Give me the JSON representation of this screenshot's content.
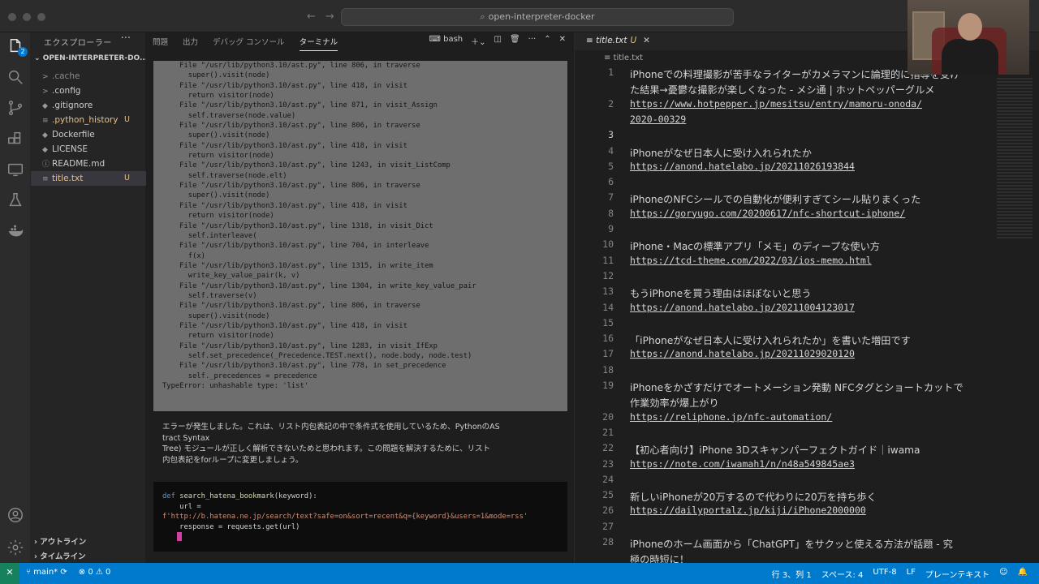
{
  "window": {
    "command_center": "open-interpreter-docker"
  },
  "explorer": {
    "title": "エクスプローラー",
    "more": "···",
    "folder": "OPEN-INTERPRETER-DO...",
    "items": [
      {
        "name": ".cache",
        "icon": ">",
        "status": ""
      },
      {
        "name": ".config",
        "icon": ">",
        "status": ""
      },
      {
        "name": ".gitignore",
        "icon": "◆",
        "status": ""
      },
      {
        "name": ".python_history",
        "icon": "≡",
        "status": "U"
      },
      {
        "name": "Dockerfile",
        "icon": "◆",
        "status": ""
      },
      {
        "name": "LICENSE",
        "icon": "◆",
        "status": ""
      },
      {
        "name": "README.md",
        "icon": "ⓘ",
        "status": ""
      },
      {
        "name": "title.txt",
        "icon": "≡",
        "status": "U"
      }
    ],
    "outline": "アウトライン",
    "timeline": "タイムライン"
  },
  "panel": {
    "tabs": [
      "問題",
      "出力",
      "デバッグ コンソール",
      "ターミナル"
    ],
    "shell": "bash",
    "traceback": [
      "    File \"/usr/lib/python3.10/ast.py\", line 806, in traverse",
      "      super().visit(node)",
      "    File \"/usr/lib/python3.10/ast.py\", line 418, in visit",
      "      return visitor(node)",
      "    File \"/usr/lib/python3.10/ast.py\", line 871, in visit_Assign",
      "      self.traverse(node.value)",
      "    File \"/usr/lib/python3.10/ast.py\", line 806, in traverse",
      "      super().visit(node)",
      "    File \"/usr/lib/python3.10/ast.py\", line 418, in visit",
      "      return visitor(node)",
      "    File \"/usr/lib/python3.10/ast.py\", line 1243, in visit_ListComp",
      "      self.traverse(node.elt)",
      "    File \"/usr/lib/python3.10/ast.py\", line 806, in traverse",
      "      super().visit(node)",
      "    File \"/usr/lib/python3.10/ast.py\", line 418, in visit",
      "      return visitor(node)",
      "    File \"/usr/lib/python3.10/ast.py\", line 1318, in visit_Dict",
      "      self.interleave(",
      "    File \"/usr/lib/python3.10/ast.py\", line 704, in interleave",
      "      f(x)",
      "    File \"/usr/lib/python3.10/ast.py\", line 1315, in write_item",
      "      write_key_value_pair(k, v)",
      "    File \"/usr/lib/python3.10/ast.py\", line 1304, in write_key_value_pair",
      "      self.traverse(v)",
      "    File \"/usr/lib/python3.10/ast.py\", line 806, in traverse",
      "      super().visit(node)",
      "    File \"/usr/lib/python3.10/ast.py\", line 418, in visit",
      "      return visitor(node)",
      "    File \"/usr/lib/python3.10/ast.py\", line 1283, in visit_IfExp",
      "      self.set_precedence(_Precedence.TEST.next(), node.body, node.test)",
      "    File \"/usr/lib/python3.10/ast.py\", line 778, in set_precedence",
      "      self._precedences = precedence",
      "TypeError: unhashable type: 'list'"
    ],
    "message_lines": [
      "エラーが発生しました。これは、リスト内包表記の中で条件式を使用しているため、PythonのAS",
      "tract Syntax",
      "Tree) モジュールが正しく解析できないためと思われます。この問題を解決するために、リスト",
      "内包表記をforループに変更しましょう。"
    ],
    "code": {
      "l1_kw": "def",
      "l1_fn": "search_hatena_bookmark",
      "l1_rest": "(keyword):",
      "l2": "    url =",
      "l3": "f'http://b.hatena.ne.jp/search/text?safe=on&sort=recent&q={keyword}&users=1&mode=rss'",
      "l4": "    response = requests.get(url)"
    }
  },
  "editor": {
    "tab": "title.txt",
    "tab_status": "U",
    "breadcrumb": "title.txt",
    "lines": [
      {
        "n": "1",
        "text": "iPhoneでの料理撮影が苦手なライターがカメラマンに論理的に指導を受け",
        "link": false
      },
      {
        "n": "",
        "text": "た結果→憂鬱な撮影が楽しくなった - メシ通 | ホットペッパーグルメ",
        "link": false
      },
      {
        "n": "2",
        "text": "https://www.hotpepper.jp/mesitsu/entry/mamoru-onoda/",
        "link": true
      },
      {
        "n": "",
        "text": "2020-00329",
        "link": true
      },
      {
        "n": "3",
        "text": "",
        "link": false
      },
      {
        "n": "4",
        "text": "iPhoneがなぜ日本人に受け入れられたか",
        "link": false
      },
      {
        "n": "5",
        "text": "https://anond.hatelabo.jp/20211026193844",
        "link": true
      },
      {
        "n": "6",
        "text": "",
        "link": false
      },
      {
        "n": "7",
        "text": "iPhoneのNFCシールでの自動化が便利すぎてシール貼りまくった",
        "link": false
      },
      {
        "n": "8",
        "text": "https://goryugo.com/20200617/nfc-shortcut-iphone/",
        "link": true
      },
      {
        "n": "9",
        "text": "",
        "link": false
      },
      {
        "n": "10",
        "text": "iPhone・Macの標準アプリ「メモ」のディープな使い方",
        "link": false
      },
      {
        "n": "11",
        "text": "https://tcd-theme.com/2022/03/ios-memo.html",
        "link": true
      },
      {
        "n": "12",
        "text": "",
        "link": false
      },
      {
        "n": "13",
        "text": "もうiPhoneを買う理由はほぼないと思う",
        "link": false
      },
      {
        "n": "14",
        "text": "https://anond.hatelabo.jp/20211004123017",
        "link": true
      },
      {
        "n": "15",
        "text": "",
        "link": false
      },
      {
        "n": "16",
        "text": "「iPhoneがなぜ日本人に受け入れられたか」を書いた増田です",
        "link": false
      },
      {
        "n": "17",
        "text": "https://anond.hatelabo.jp/20211029020120",
        "link": true
      },
      {
        "n": "18",
        "text": "",
        "link": false
      },
      {
        "n": "19",
        "text": "iPhoneをかざすだけでオートメーション発動 NFCタグとショートカットで",
        "link": false
      },
      {
        "n": "",
        "text": "作業効率が爆上がり",
        "link": false
      },
      {
        "n": "20",
        "text": "https://reliphone.jp/nfc-automation/",
        "link": true
      },
      {
        "n": "21",
        "text": "",
        "link": false
      },
      {
        "n": "22",
        "text": "【初心者向け】iPhone 3Dスキャンパーフェクトガイド｜iwama",
        "link": false
      },
      {
        "n": "23",
        "text": "https://note.com/iwamah1/n/n48a549845ae3",
        "link": true
      },
      {
        "n": "24",
        "text": "",
        "link": false
      },
      {
        "n": "25",
        "text": "新しいiPhoneが20万するので代わりに20万を持ち歩く",
        "link": false
      },
      {
        "n": "26",
        "text": "https://dailyportalz.jp/kiji/iPhone2000000",
        "link": true
      },
      {
        "n": "27",
        "text": "",
        "link": false
      },
      {
        "n": "28",
        "text": "iPhoneのホーム画面から「ChatGPT」をサクッと使える方法が話題 - 究",
        "link": false
      },
      {
        "n": "",
        "text": "極の時短に！",
        "link": false
      }
    ]
  },
  "statusbar": {
    "branch": "main*",
    "problems": "⊗ 0 ⚠ 0",
    "position": "行 3、列 1",
    "spaces": "スペース: 4",
    "encoding": "UTF-8",
    "eol": "LF",
    "language": "プレーンテキスト"
  }
}
